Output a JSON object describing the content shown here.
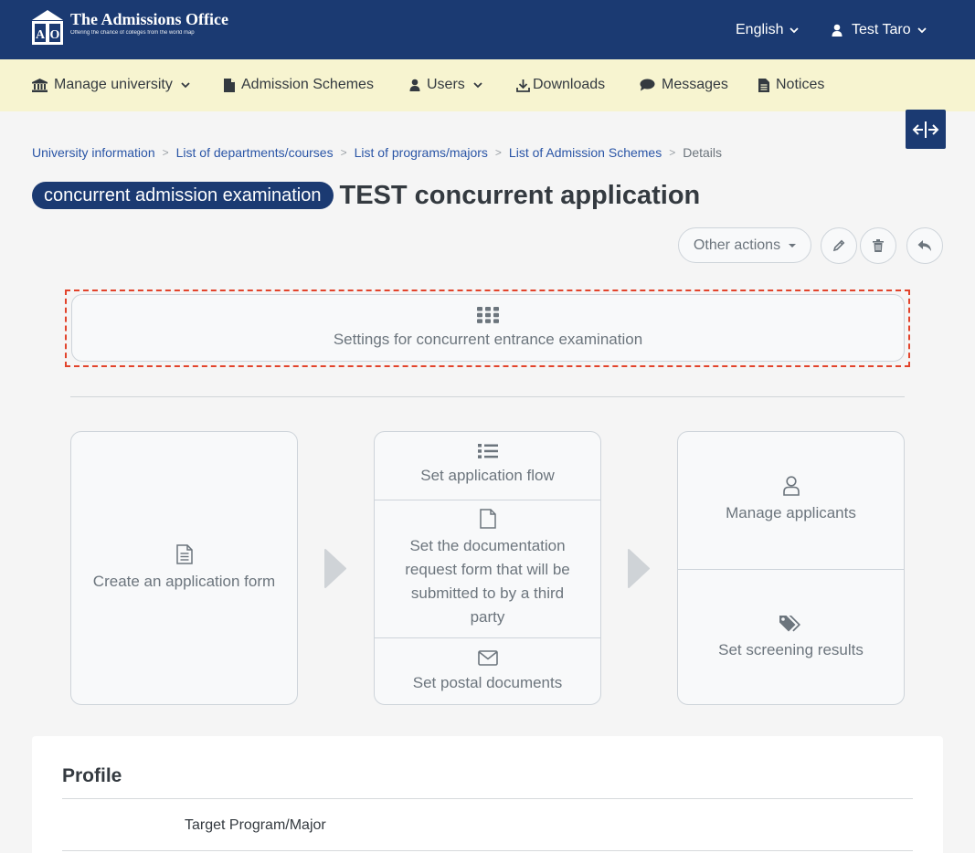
{
  "header": {
    "logo_title": "The Admissions Office",
    "logo_subtitle": "Offering the chance of colleges from the world map",
    "logo_letters": "A O",
    "language": "English",
    "user_name": "Test Taro"
  },
  "nav": {
    "items": [
      {
        "label": "Manage university",
        "icon": "bank-icon",
        "dropdown": true
      },
      {
        "label": "Admission Schemes",
        "icon": "file-icon",
        "dropdown": false
      },
      {
        "label": "Users",
        "icon": "user-icon",
        "dropdown": true
      },
      {
        "label": "Downloads",
        "icon": "download-icon",
        "dropdown": false
      },
      {
        "label": "Messages",
        "icon": "comment-icon",
        "dropdown": false
      },
      {
        "label": "Notices",
        "icon": "document-icon",
        "dropdown": false
      }
    ]
  },
  "breadcrumb": {
    "items": [
      "University information",
      "List of departments/courses",
      "List of programs/majors",
      "List of Admission Schemes"
    ],
    "current": "Details",
    "separator": ">"
  },
  "page": {
    "badge": "concurrent admission examination",
    "title": "TEST concurrent application"
  },
  "actions": {
    "other_actions": "Other actions"
  },
  "settings_button": {
    "label": "Settings for concurrent entrance examination",
    "icon": "grid-icon"
  },
  "flow": {
    "create_form": "Create an application form",
    "set_flow": "Set application flow",
    "doc_request": "Set the documentation request form that will be submitted to by a third party",
    "postal_docs": "Set postal documents",
    "manage_applicants": "Manage applicants",
    "screening_results": "Set screening results"
  },
  "profile": {
    "title": "Profile",
    "first_label": "Target Program/Major"
  },
  "colors": {
    "header_bg": "#1b3a72",
    "nav_bg": "#f7f4d0",
    "highlight": "#e2432b",
    "link": "#2a55a6"
  }
}
